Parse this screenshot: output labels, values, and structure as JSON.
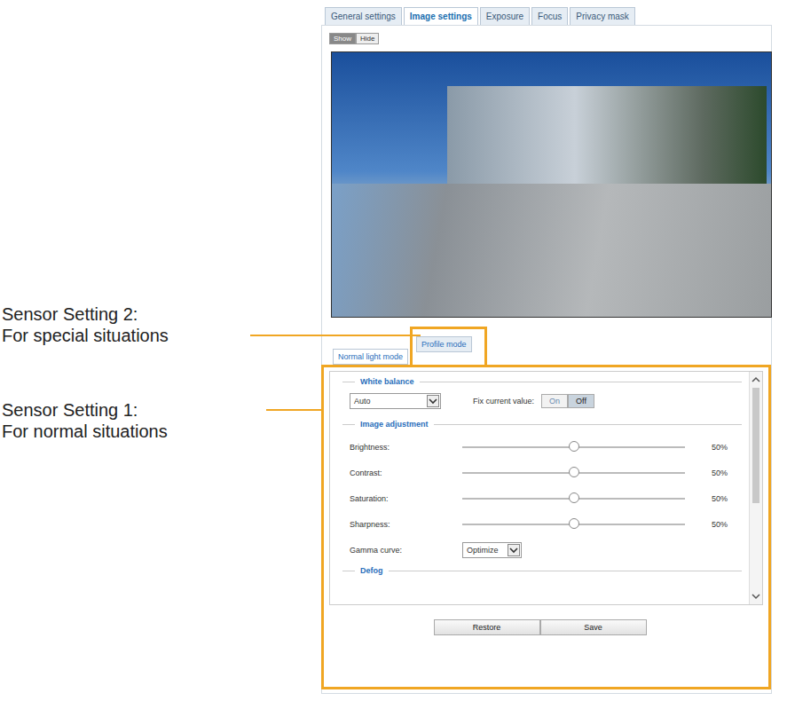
{
  "callouts": [
    {
      "title": "Sensor Setting 2:",
      "text": "For special situations"
    },
    {
      "title": "Sensor Setting 1:",
      "text": "For normal situations"
    }
  ],
  "tabs": [
    {
      "label": "General settings",
      "selected": false
    },
    {
      "label": "Image settings",
      "selected": true
    },
    {
      "label": "Exposure",
      "selected": false
    },
    {
      "label": "Focus",
      "selected": false
    },
    {
      "label": "Privacy mask",
      "selected": false
    }
  ],
  "view_toggle": [
    {
      "label": "Show",
      "selected": true
    },
    {
      "label": "Hide",
      "selected": false
    }
  ],
  "mode_tabs": [
    {
      "label": "Normal light mode",
      "selected": true,
      "highlighted": false
    },
    {
      "label": "Profile mode",
      "selected": false,
      "highlighted": true
    }
  ],
  "white_balance": {
    "legend": "White balance",
    "mode": "Auto",
    "fix_label": "Fix current value:",
    "toggle": [
      {
        "label": "On",
        "selected": false
      },
      {
        "label": "Off",
        "selected": true
      }
    ]
  },
  "image_adjustment": {
    "legend": "Image adjustment",
    "sliders": [
      {
        "label": "Brightness:",
        "level": 0.5,
        "reading": "50%"
      },
      {
        "label": "Contrast:",
        "level": 0.5,
        "reading": "50%"
      },
      {
        "label": "Saturation:",
        "level": 0.5,
        "reading": "50%"
      },
      {
        "label": "Sharpness:",
        "level": 0.5,
        "reading": "50%"
      }
    ],
    "gamma": {
      "label": "Gamma curve:",
      "value": "Optimize"
    }
  },
  "next_section": {
    "legend": "Defog"
  },
  "buttons": [
    "Restore",
    "Save"
  ]
}
